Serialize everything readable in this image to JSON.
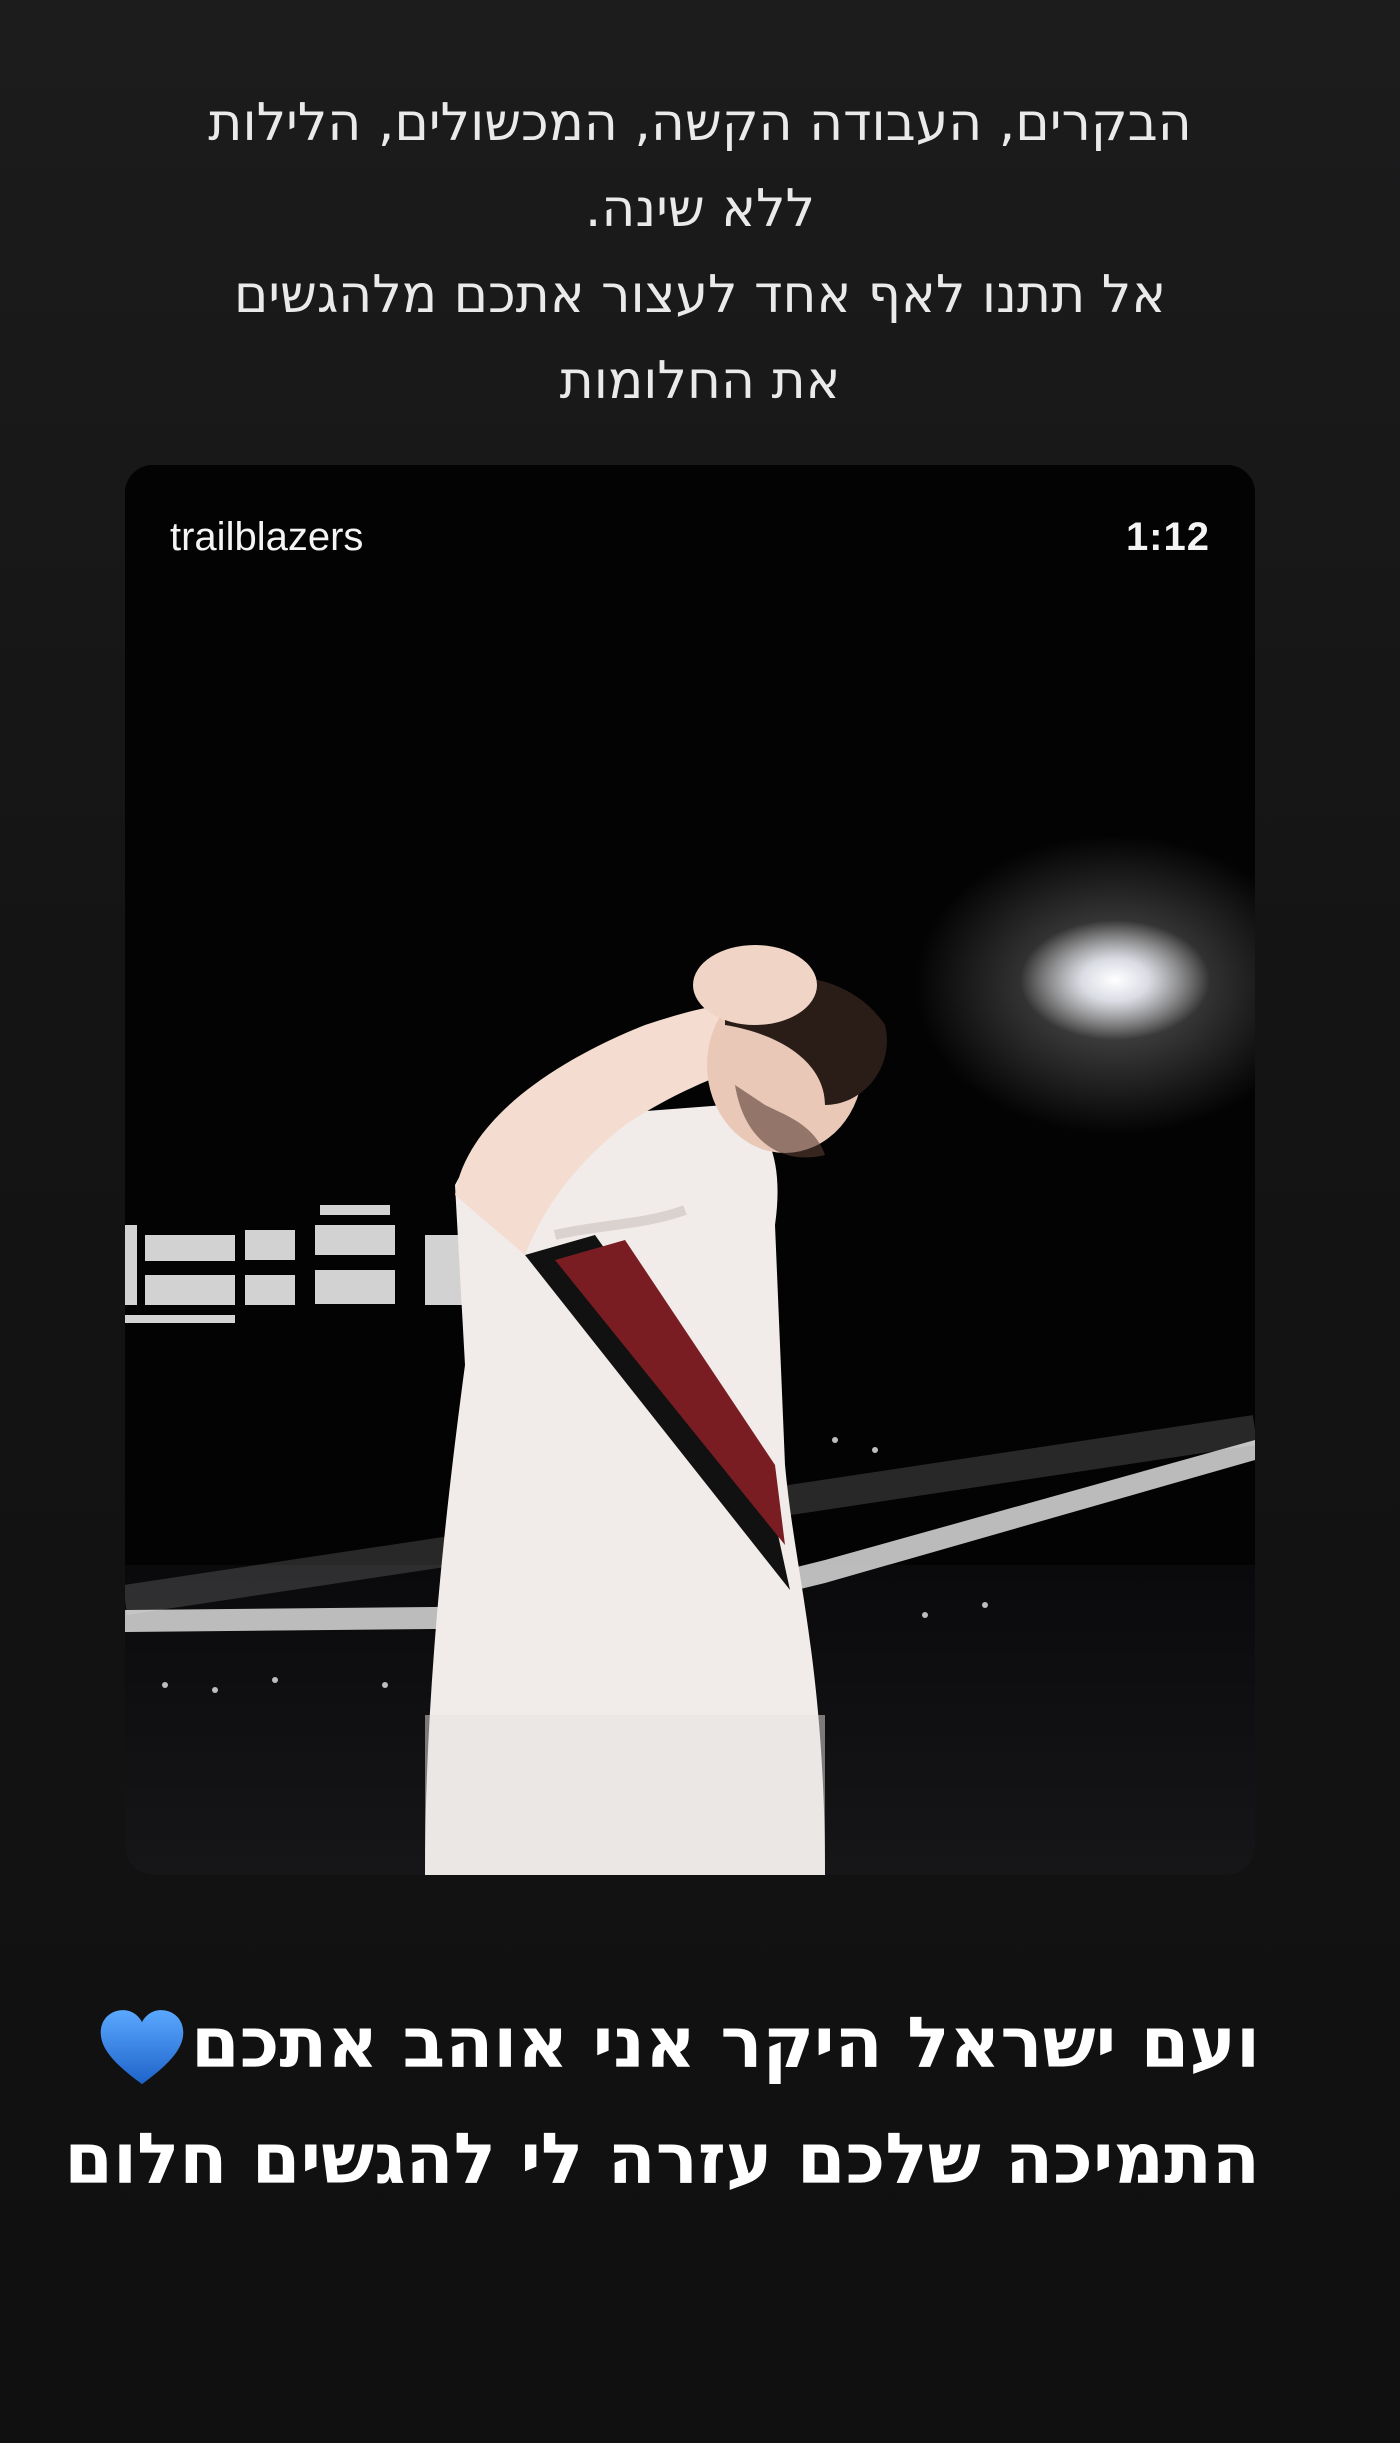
{
  "story": {
    "caption_top": {
      "line1": "הבקרים, העבודה הקשה, המכשולים, הלילות",
      "line2": "ללא שינה.",
      "line3": "אל תתנו לאף אחד לעצור אתכם מלהגשים",
      "line4": "את החלומות"
    },
    "reel": {
      "username": "trailblazers",
      "duration": "1:12"
    },
    "caption_bottom": {
      "line1": "ועם ישראל היקר אני אוהב אתכם",
      "line2": "התמיכה שלכם עזרה לי להגשים חלום",
      "emoji": "blue-heart-icon"
    }
  },
  "colors": {
    "background": "#141414",
    "heart": "#2f7fe0",
    "jersey_red": "#7a1d22"
  }
}
